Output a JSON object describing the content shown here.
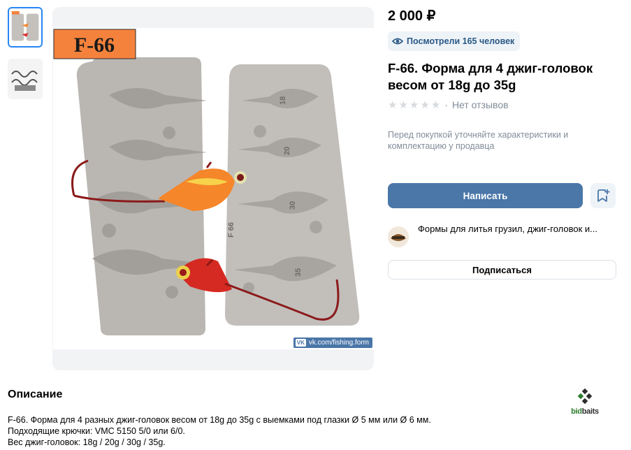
{
  "product": {
    "price": "2 000 ₽",
    "views": "Посмотрели 165 человек",
    "title": "F-66. Форма для 4 джиг-головок весом от 18g до 35g",
    "reviews": "Нет отзывов",
    "rating_stars": 5,
    "note": "Перед покупкой уточняйте характеристики и комплектацию у продавца"
  },
  "buttons": {
    "write": "Написать",
    "subscribe": "Подписаться"
  },
  "shop": {
    "name": "Формы для литья грузил, джиг-головок и..."
  },
  "photo": {
    "label": "F-66",
    "watermark_vk": "VK",
    "watermark_text": "vk.com/fishing.form",
    "mold_marks": [
      "18",
      "20",
      "30",
      "35",
      "F 66"
    ]
  },
  "description": {
    "heading": "Описание",
    "lines": [
      "F-66. Форма для 4 разных джиг-головок весом от 18g до 35g с выемками под глазки Ø 5 мм или Ø 6 мм.",
      "Подходящие крючки: VMC 5150 5/0 или 6/0.",
      "Вес джиг-головок: 18g / 20g / 30g / 35g."
    ]
  },
  "branding": {
    "logo_bid": "bid",
    "logo_baits": "baits"
  },
  "colors": {
    "accent": "#4a76a8",
    "link": "#2a5885",
    "muted": "#818c99",
    "label_bg": "#f5823c"
  },
  "icons": {
    "views": "eye-icon",
    "bookmark": "bookmark-add-icon",
    "star": "star-icon"
  }
}
